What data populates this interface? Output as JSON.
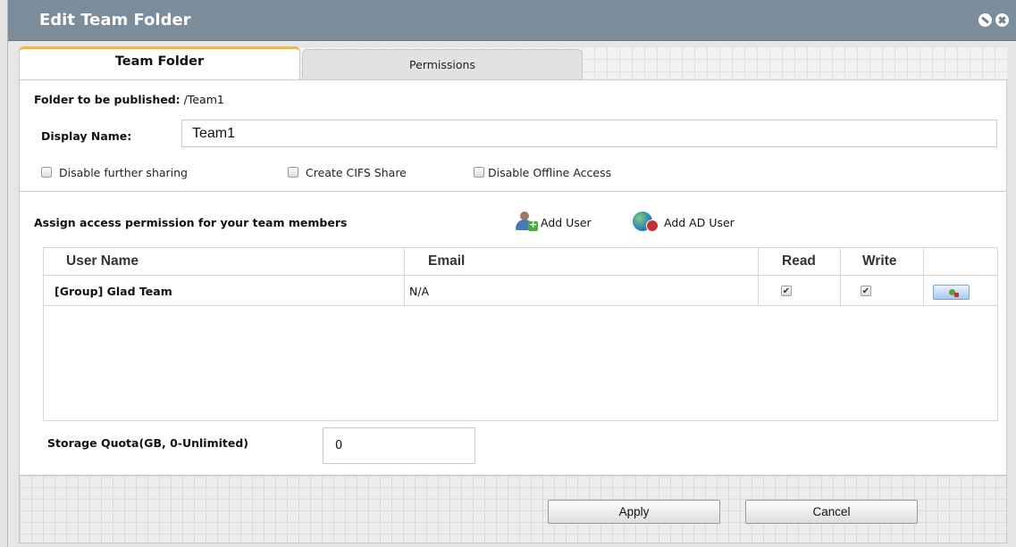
{
  "dialog": {
    "title": "Edit Team Folder"
  },
  "tabs": [
    {
      "label": "Team Folder",
      "active": true
    },
    {
      "label": "Permissions",
      "active": false
    }
  ],
  "folder": {
    "published_label": "Folder to be published:",
    "published_value": " /Team1",
    "display_name_label": "Display Name:",
    "display_name_value": "Team1"
  },
  "options": [
    {
      "label": "Disable further sharing",
      "checked": false
    },
    {
      "label": "Create CIFS Share",
      "checked": false
    },
    {
      "label": "Disable Offline Access",
      "checked": false
    }
  ],
  "permissions": {
    "heading": "Assign access permission for your team members",
    "add_user_label": "Add User",
    "add_ad_user_label": "Add AD User",
    "columns": [
      "User Name",
      "Email",
      "Read",
      "Write"
    ],
    "rows": [
      {
        "user_name": "[Group] Glad Team",
        "email": "N/A",
        "read": true,
        "write": true
      }
    ]
  },
  "quota": {
    "label": "Storage Quota(GB, 0-Unlimited)",
    "value": "0"
  },
  "buttons": {
    "apply": "Apply",
    "cancel": "Cancel"
  },
  "colors": {
    "titlebar": "#7b8c9a",
    "active_tab_accent": "#f0b840"
  },
  "icons": [
    "minimize-icon",
    "close-icon",
    "add-user-icon",
    "add-ad-user-icon",
    "delete-user-icon"
  ]
}
